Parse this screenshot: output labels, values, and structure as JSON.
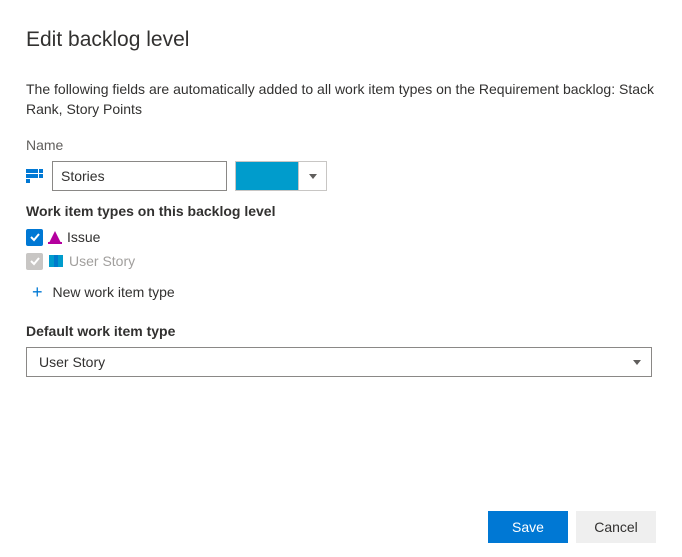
{
  "title": "Edit backlog level",
  "description": "The following fields are automatically added to all work item types on the Requirement backlog: Stack Rank, Story Points",
  "name_label": "Name",
  "name_value": "Stories",
  "color_value": "#009ccc",
  "wit_section_label": "Work item types on this backlog level",
  "work_item_types": [
    {
      "checked": true,
      "disabled": false,
      "label": "Issue"
    },
    {
      "checked": true,
      "disabled": true,
      "label": "User Story"
    }
  ],
  "new_wit_label": "New work item type",
  "default_label": "Default work item type",
  "default_value": "User Story",
  "buttons": {
    "save": "Save",
    "cancel": "Cancel"
  }
}
